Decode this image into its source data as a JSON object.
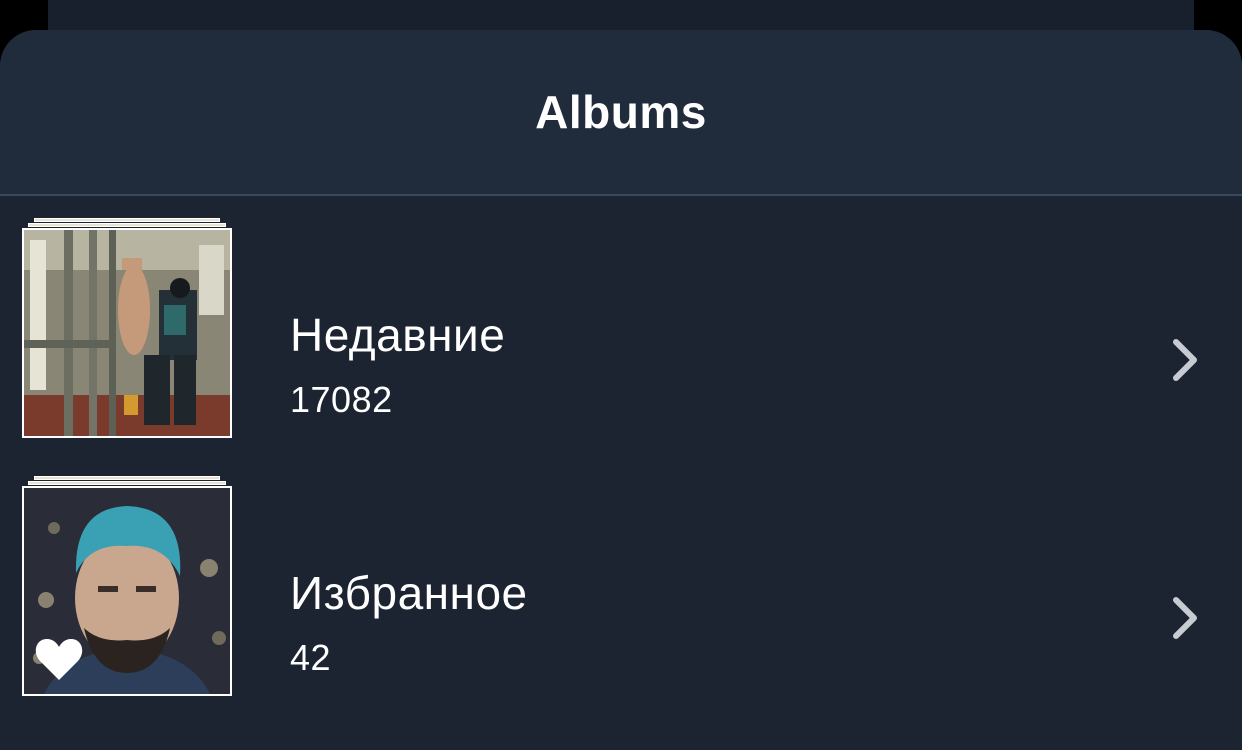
{
  "header": {
    "title": "Albums"
  },
  "albums": [
    {
      "name": "Недавние",
      "count": "17082",
      "thumbnail": "subway-car-photo",
      "icon": "chevron-right-icon"
    },
    {
      "name": "Избранное",
      "count": "42",
      "thumbnail": "portrait-blue-hair-photo",
      "badge_icon": "heart-icon",
      "icon": "chevron-right-icon"
    }
  ],
  "colors": {
    "background": "#1c2431",
    "header": "#202c3c",
    "text": "#ffffff",
    "chevron": "#c8ccd2"
  }
}
